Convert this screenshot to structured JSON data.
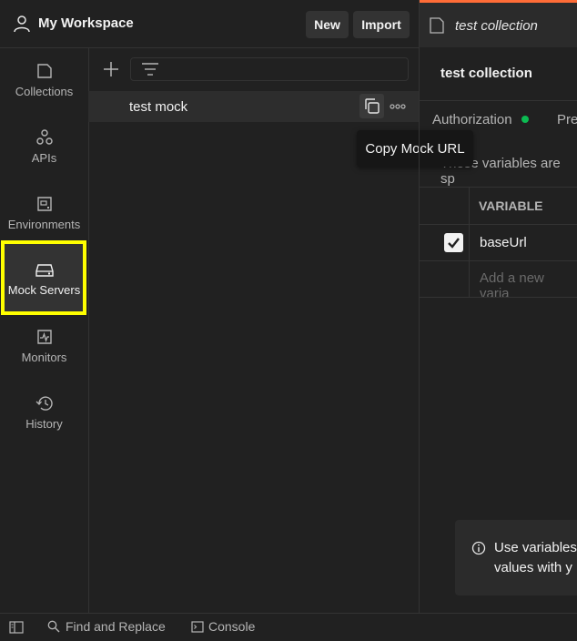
{
  "header": {
    "workspace_title": "My Workspace",
    "new_label": "New",
    "import_label": "Import"
  },
  "sidebar": {
    "items": [
      {
        "label": "Collections",
        "icon": "collections-icon"
      },
      {
        "label": "APIs",
        "icon": "apis-icon"
      },
      {
        "label": "Environments",
        "icon": "environments-icon"
      },
      {
        "label": "Mock Servers",
        "icon": "mock-servers-icon",
        "selected": true
      },
      {
        "label": "Monitors",
        "icon": "monitors-icon"
      },
      {
        "label": "History",
        "icon": "history-icon"
      }
    ]
  },
  "mock_list": {
    "items": [
      {
        "name": "test mock"
      }
    ],
    "tooltip": "Copy Mock URL"
  },
  "editor": {
    "tab_title": "test collection",
    "collection_title": "test collection",
    "tabs": [
      {
        "label": "Authorization",
        "status_color": "#0cbb52"
      },
      {
        "label": "Pre"
      }
    ],
    "description": "These variables are sp",
    "table": {
      "header": "VARIABLE",
      "rows": [
        {
          "checked": true,
          "name": "baseUrl"
        }
      ],
      "add_placeholder": "Add a new varia"
    },
    "info": {
      "line1": "Use variables",
      "line2": "values with y"
    }
  },
  "footer": {
    "find_label": "Find and Replace",
    "console_label": "Console"
  },
  "colors": {
    "highlight": "#ffff00",
    "accent": "#ff6c37",
    "status_green": "#0cbb52"
  }
}
